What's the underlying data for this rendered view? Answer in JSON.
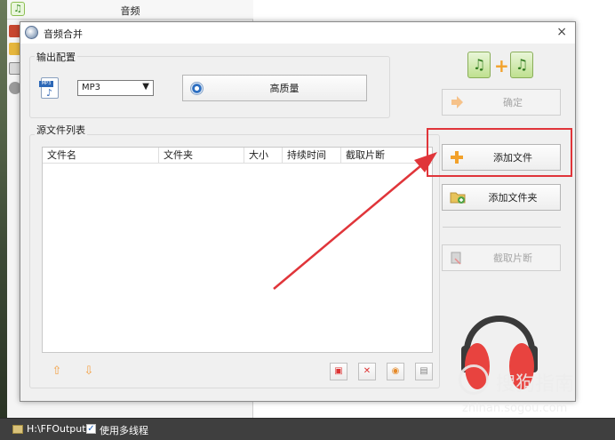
{
  "background_app": {
    "audio_row_label": "音频",
    "audio_icon_glyph": "♫",
    "status_bar": {
      "output_path": "H:\\FFOutput",
      "multithread_checked": true,
      "multithread_label": "使用多线程"
    }
  },
  "dialog": {
    "title": "音频合并",
    "close_glyph": "×",
    "output_config": {
      "section_label": "输出配置",
      "format_icon_tag": "MP3",
      "format_select": {
        "value": "MP3",
        "arrow": "▼"
      },
      "quality_button_label": "高质量"
    },
    "source_list": {
      "section_label": "源文件列表",
      "columns": [
        "文件名",
        "文件夹",
        "大小",
        "持续时间",
        "截取片断"
      ],
      "rows": []
    },
    "side_buttons": {
      "confirm": {
        "label": "确定",
        "enabled": false
      },
      "add_file": {
        "label": "添加文件",
        "enabled": true
      },
      "add_folder": {
        "label": "添加文件夹",
        "enabled": true
      },
      "cut_segment": {
        "label": "截取片断",
        "enabled": false
      }
    },
    "merge_icon": {
      "left_glyph": "♫",
      "plus": "+",
      "right_glyph": "♫"
    }
  },
  "annotation": {
    "highlight_color": "#e0353a",
    "target": "添加文件"
  },
  "watermark": {
    "text": "搜狗指南",
    "url": "zhinan.sogou.com"
  },
  "colors": {
    "accent_orange": "#f2a12b",
    "headphone_red": "#e8433f",
    "headphone_dark": "#3a3a3a"
  }
}
